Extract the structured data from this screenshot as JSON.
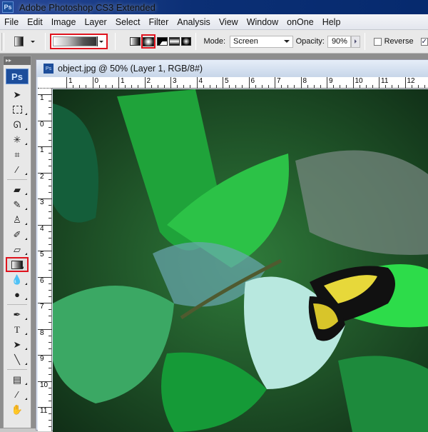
{
  "app": {
    "title": "Adobe Photoshop CS3 Extended",
    "logo": "Ps"
  },
  "menu": [
    "File",
    "Edit",
    "Image",
    "Layer",
    "Select",
    "Filter",
    "Analysis",
    "View",
    "Window",
    "onOne",
    "Help"
  ],
  "options": {
    "tool_preset_icon": "gradient-preset-icon",
    "gradient_picker": "gradient-editor",
    "gradient_types": [
      {
        "name": "linear",
        "selected": false
      },
      {
        "name": "radial",
        "selected": true
      },
      {
        "name": "angle",
        "selected": false
      },
      {
        "name": "reflected",
        "selected": false
      },
      {
        "name": "diamond",
        "selected": false
      }
    ],
    "mode_label": "Mode:",
    "mode_value": "Screen",
    "opacity_label": "Opacity:",
    "opacity_value": "90%",
    "reverse_label": "Reverse",
    "reverse_checked": false,
    "dither_checked": true
  },
  "toolbox": {
    "logo": "Ps",
    "tools": [
      "move",
      "marquee",
      "lasso",
      "magic-wand",
      "crop",
      "slice",
      "healing-brush",
      "brush",
      "clone-stamp",
      "history-brush",
      "eraser",
      "gradient",
      "blur",
      "dodge",
      "pen",
      "type",
      "path-selection",
      "line",
      "notes",
      "eyedropper",
      "hand"
    ],
    "selected": "gradient"
  },
  "document": {
    "title": "object.jpg @ 50% (Layer 1, RGB/8#)",
    "h_ruler": [
      "1",
      "0",
      "1",
      "2",
      "3",
      "4",
      "5",
      "6",
      "7",
      "8",
      "9",
      "10",
      "11",
      "12"
    ],
    "v_ruler": [
      "1",
      "0",
      "1",
      "2",
      "3",
      "4",
      "5",
      "6",
      "7",
      "8",
      "9",
      "10",
      "11"
    ]
  },
  "colors": {
    "highlight": "#e0141e",
    "title_bar": "#0b2f75"
  }
}
